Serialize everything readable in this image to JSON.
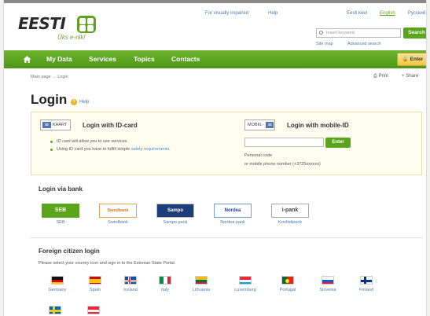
{
  "header": {
    "logo_text": "EESTI",
    "tagline": "Üks e-riik!",
    "accessibility_link": "For visually impaired",
    "help_link": "Help",
    "lang_et": "Eesti keel",
    "lang_en": "English",
    "lang_ru": "Русский",
    "search_placeholder": "Insert keyword",
    "search_button": "Search",
    "sitemap": "Site map",
    "advanced_search": "Advanced search"
  },
  "nav": {
    "items": [
      "My Data",
      "Services",
      "Topics",
      "Contacts"
    ],
    "enter_button": "Enter"
  },
  "breadcrumb": {
    "home": "Main page",
    "separator": "→",
    "current": "Login"
  },
  "tools": {
    "print": "Print",
    "share": "Share"
  },
  "page": {
    "title": "Login",
    "help": "Help"
  },
  "id_card": {
    "badge": "KAART",
    "badge_icon": "ID",
    "title": "Login with ID-card",
    "bullet1": "ID card will allow you to use services",
    "bullet2_prefix": "Using ID card you have to fulfill simple ",
    "bullet2_link": "safety requirements",
    "bullet2_suffix": "."
  },
  "mobile_id": {
    "badge": "MOBIIL-",
    "badge_icon": "ID",
    "title": "Login with mobile-ID",
    "enter_button": "Enter",
    "code_label": "Personal code",
    "phone_label": "or mobile phone number (+3725xxxxxx)"
  },
  "bank": {
    "title": "Login via bank",
    "banks": [
      {
        "logo": "SEB",
        "name": "SEB"
      },
      {
        "logo": "Swedbank",
        "name": "Swedbank"
      },
      {
        "logo": "Sampo",
        "name": "Sampo pank"
      },
      {
        "logo": "Nordea",
        "name": "Nordea pank"
      },
      {
        "logo": "i-pank",
        "name": "Krediidipank"
      }
    ]
  },
  "foreign": {
    "title": "Foreign citizen login",
    "description": "Please select your country icon and sign in to the Estonian State Portal.",
    "countries": [
      "Germany",
      "Spain",
      "Iceland",
      "Italy",
      "Lithuania",
      "Luxemburg",
      "Portugal",
      "Slovenia",
      "Finland"
    ]
  },
  "colors": {
    "brand_green": "#5aa51c",
    "link_blue": "#4a7aa8",
    "enter_yellow": "#f3c440"
  }
}
